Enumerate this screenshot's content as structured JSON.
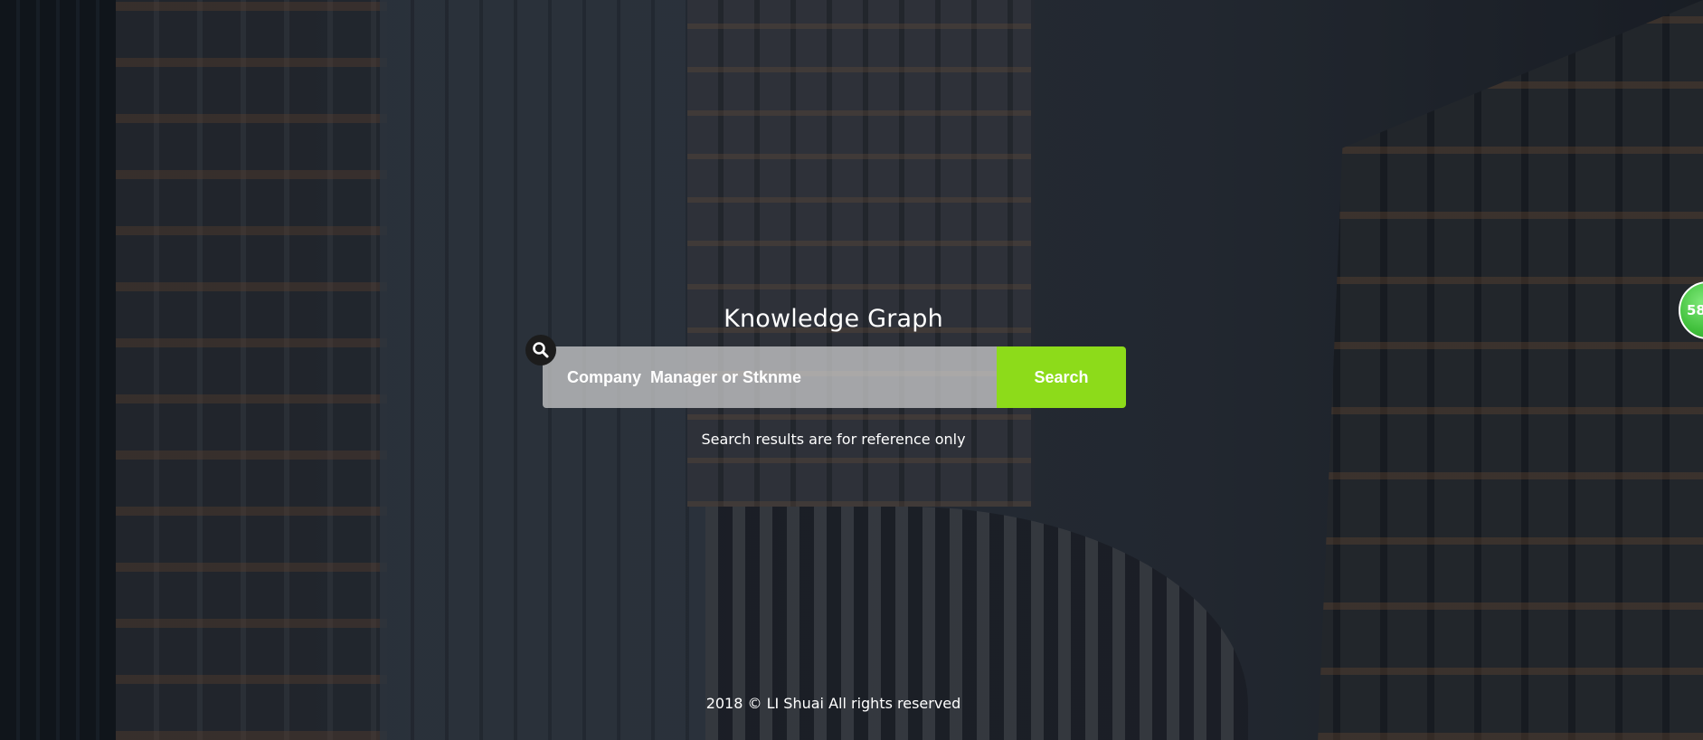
{
  "header": {
    "title": "Knowledge Graph"
  },
  "search": {
    "placeholder": "Company  Manager or Stknme",
    "value": "",
    "button_label": "Search",
    "icon": "search-icon"
  },
  "note": {
    "text": "Search results are for reference only"
  },
  "footer": {
    "text": "2018 © LI Shuai All rights reserved"
  },
  "badge": {
    "text": "58"
  },
  "colors": {
    "accent": "#8ddb1a",
    "badge": "#3fbf3a",
    "text": "#ffffff"
  }
}
